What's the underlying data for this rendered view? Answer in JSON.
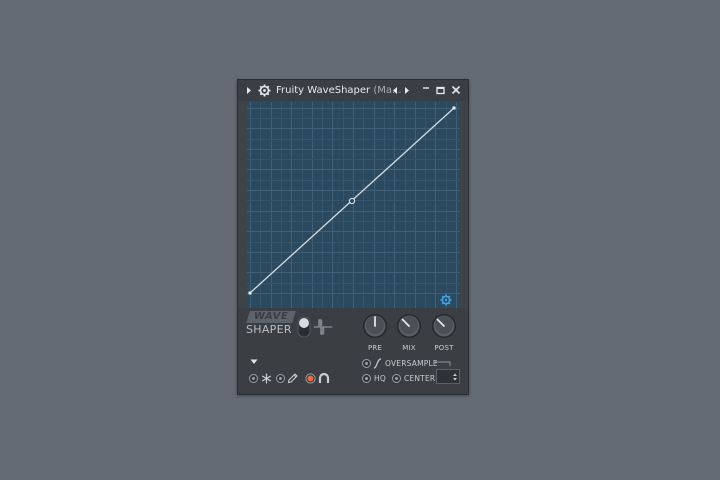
{
  "window": {
    "title": "Fruity WaveShaper",
    "title_suffix": "(Ma..."
  },
  "titlebar": {
    "icons": [
      "play-arrow-icon",
      "gear-icon",
      "prev-arrow-icon",
      "next-arrow-icon",
      "minimize-icon",
      "maximize-icon",
      "close-icon"
    ]
  },
  "graph": {
    "curve": "linear",
    "background": "#2b4a5f",
    "curve_color": "#d6dde2",
    "settings_icon": "gear-icon",
    "settings_icon_color": "#3fa3e6"
  },
  "logo": {
    "line1": "WAVE",
    "line2": "SHAPER"
  },
  "knobs": [
    {
      "label": "PRE"
    },
    {
      "label": "MIX"
    },
    {
      "label": "POST"
    }
  ],
  "options": {
    "oversample_label": "OVERSAMPLE",
    "hq_label": "HQ",
    "center_label": "CENTER"
  },
  "tools": {
    "icons": [
      "radio-icon",
      "snowflake-icon",
      "radio-icon",
      "pencil-icon",
      "record-icon",
      "magnet-icon"
    ],
    "record_color": "#f06a3c"
  }
}
